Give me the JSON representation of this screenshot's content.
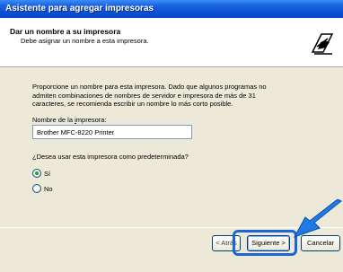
{
  "window": {
    "title": "Asistente para agregar impresoras"
  },
  "header": {
    "title": "Dar un nombre a su impresora",
    "subtitle": "Debe asignar un nombre a esta impresora."
  },
  "body": {
    "description": "Proporcione un nombre para esta impresora. Dado que algunos programas no admiten combinaciones de nombres de servidor e impresora de más de 31 caracteres, se recomienda escribir un nombre lo más corto posible.",
    "printer_name_label": "Nombre de la impresora:",
    "printer_name_value": "Brother MFC-8220 Printer",
    "default_question": "¿Desea usar esta impresora como predeterminada?",
    "options": [
      {
        "label": "Sí",
        "checked": true
      },
      {
        "label": "No",
        "checked": false
      }
    ]
  },
  "footer": {
    "back_label": "< Atrás",
    "next_label": "Siguiente >",
    "cancel_label": "Cancelar"
  },
  "colors": {
    "titlebar": "#0a4fd4",
    "highlight": "#1a66d6",
    "arrow": "#1f7ae6"
  },
  "icons": {
    "header": "printer-wizard-icon",
    "annotation": "pointer-arrow-icon"
  }
}
